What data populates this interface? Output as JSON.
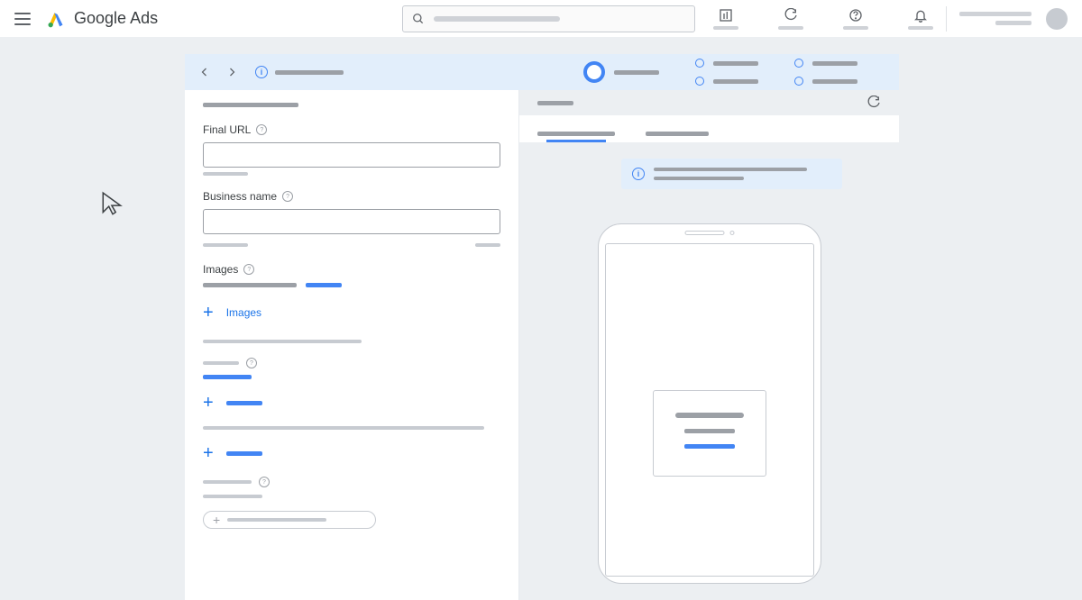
{
  "brand": {
    "name_a": "Google",
    "name_b": "Ads"
  },
  "form": {
    "final_url_label": "Final URL",
    "business_name_label": "Business name",
    "images_label": "Images",
    "add_images_label": "Images"
  }
}
